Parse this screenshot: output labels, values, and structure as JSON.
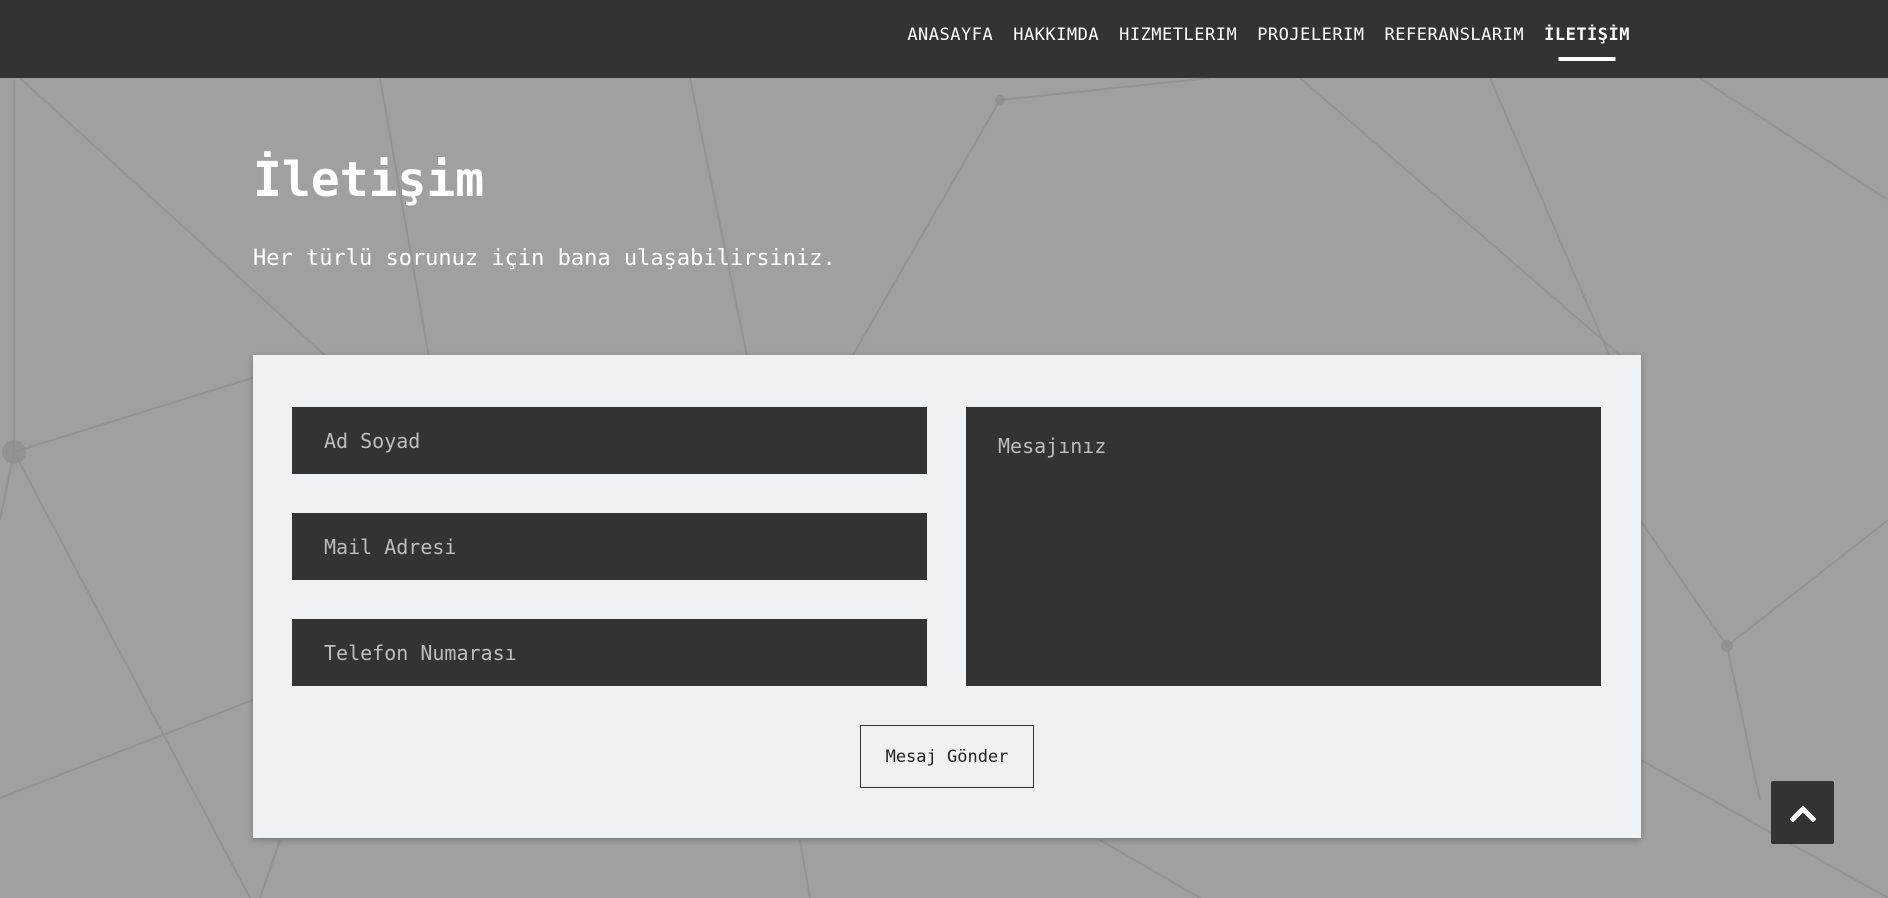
{
  "nav": {
    "items": [
      {
        "label": "ANASAYFA"
      },
      {
        "label": "HAKKIMDA"
      },
      {
        "label": "HIZMETLERIM"
      },
      {
        "label": "PROJELERIM"
      },
      {
        "label": "REFERANSLARIM"
      },
      {
        "label": "İLETİŞİM",
        "active": true
      }
    ]
  },
  "contact": {
    "title": "İletişim",
    "subtitle": "Her türlü sorunuz için bana ulaşabilirsiniz."
  },
  "form": {
    "name_placeholder": "Ad Soyad",
    "mail_placeholder": "Mail Adresi",
    "phone_placeholder": "Telefon Numarası",
    "message_placeholder": "Mesajınız",
    "submit_label": "Mesaj Gönder"
  },
  "icons": {
    "scroll_top": "chevron-up-icon"
  },
  "colors": {
    "navbar_bg": "#333333",
    "page_bg": "#a0a0a0",
    "card_bg": "#f0f1f2",
    "field_bg": "#333333"
  }
}
